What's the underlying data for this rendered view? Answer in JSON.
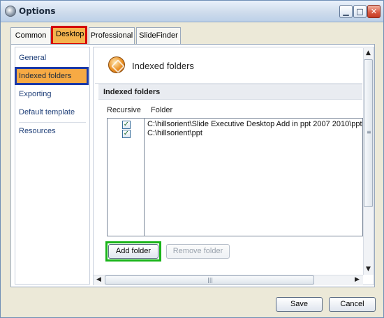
{
  "window": {
    "title": "Options"
  },
  "tabs": [
    {
      "label": "Common"
    },
    {
      "label": "Desktop"
    },
    {
      "label": "Professional"
    },
    {
      "label": "SlideFinder"
    }
  ],
  "sidebar": {
    "items": [
      {
        "label": "General"
      },
      {
        "label": "Indexed folders"
      },
      {
        "label": "Exporting"
      },
      {
        "label": "Default template"
      },
      {
        "label": "Resources"
      }
    ]
  },
  "content": {
    "header_title": "Indexed folders",
    "section_title": "Indexed folders",
    "columns": {
      "recursive": "Recursive",
      "folder": "Folder"
    },
    "rows": [
      {
        "recursive": true,
        "folder": "C:\\hillsorient\\Slide Executive Desktop Add in ppt 2007 2010\\ppt"
      },
      {
        "recursive": true,
        "folder": "C:\\hillsorient\\ppt"
      }
    ],
    "add_folder_label": "Add folder",
    "remove_folder_label": "Remove folder"
  },
  "footer": {
    "save_label": "Save",
    "cancel_label": "Cancel"
  },
  "colors": {
    "selected_tab_highlight": "#d40000",
    "selected_sidebar_highlight": "#1c3aa8",
    "add_button_highlight": "#18b418",
    "selection_fill": "#f7aa44"
  },
  "icons": {
    "window": "options-gear-icon",
    "header": "indexed-folders-icon",
    "checkbox": "checkmark-icon",
    "minimize": "minimize-icon",
    "maximize": "maximize-icon",
    "close": "close-icon"
  }
}
